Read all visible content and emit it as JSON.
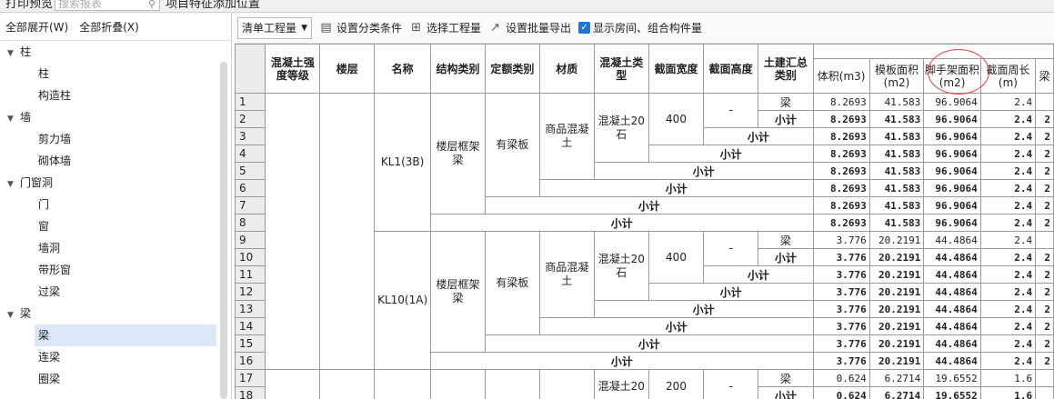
{
  "topbar": {
    "left_label": "打印预览",
    "search_placeholder": "搜索报表",
    "right_label": "项目特征添加位置"
  },
  "left_panel": {
    "toolbar": {
      "expand_all": "全部展开(W)",
      "collapse_all": "全部折叠(X)"
    },
    "tree": [
      {
        "label": "柱",
        "group": true
      },
      {
        "label": "柱"
      },
      {
        "label": "构造柱"
      },
      {
        "label": "墙",
        "group": true
      },
      {
        "label": "剪力墙"
      },
      {
        "label": "砌体墙"
      },
      {
        "label": "门窗洞",
        "group": true
      },
      {
        "label": "门"
      },
      {
        "label": "窗"
      },
      {
        "label": "墙洞"
      },
      {
        "label": "带形窗"
      },
      {
        "label": "过梁"
      },
      {
        "label": "梁",
        "group": true
      },
      {
        "label": "梁",
        "selected": true
      },
      {
        "label": "连梁"
      },
      {
        "label": "圈梁"
      }
    ]
  },
  "main_toolbar": {
    "report_select": "清单工程量",
    "set_category": "设置分类条件",
    "select_quantities": "选择工程量",
    "batch_export": "设置批量导出",
    "show_rooms": "显示房间、组合构件量",
    "show_rooms_checked": true
  },
  "table": {
    "headers": [
      "混凝土强度等级",
      "楼层",
      "名称",
      "结构类别",
      "定额类别",
      "材质",
      "混凝土类型",
      "截面宽度",
      "截面高度",
      "土建汇总类别"
    ],
    "qty_headers": [
      "体积(m3)",
      "模板面积(m2)",
      "脚手架面积(m2)",
      "截面周长(m)",
      "梁"
    ],
    "row_numbers": [
      "1",
      "2",
      "3",
      "4",
      "5",
      "6",
      "7",
      "8",
      "9",
      "10",
      "11",
      "12",
      "13",
      "14",
      "15",
      "16",
      "17",
      "18"
    ],
    "groups": [
      {
        "name": "KL1(3B)",
        "struct": "楼层框架梁",
        "quota": "有梁板",
        "material": "商品混凝土",
        "concrete": "混凝土20石",
        "width": "400",
        "height": "-",
        "detail": [
          "8.2693",
          "41.583",
          "96.9064",
          "2.4",
          ""
        ],
        "subtotal": [
          "8.2693",
          "41.583",
          "96.9064",
          "2.4",
          "2"
        ]
      },
      {
        "name": "KL10(1A)",
        "struct": "楼层框架梁",
        "quota": "有梁板",
        "material": "商品混凝土",
        "concrete": "混凝土20石",
        "width": "400",
        "height": "-",
        "detail": [
          "3.776",
          "20.2191",
          "44.4864",
          "2.4",
          ""
        ],
        "subtotal": [
          "3.776",
          "20.2191",
          "44.4864",
          "2.4",
          "2"
        ]
      },
      {
        "concrete": "混凝土20",
        "width": "200",
        "height": "-",
        "detail": [
          "0.624",
          "6.2714",
          "19.6552",
          "1.6",
          ""
        ],
        "subtotal": [
          "0.624",
          "6.2714",
          "19.6552",
          "1.6",
          ""
        ]
      }
    ],
    "beam_label": "梁",
    "subtotal_label": "小计"
  }
}
